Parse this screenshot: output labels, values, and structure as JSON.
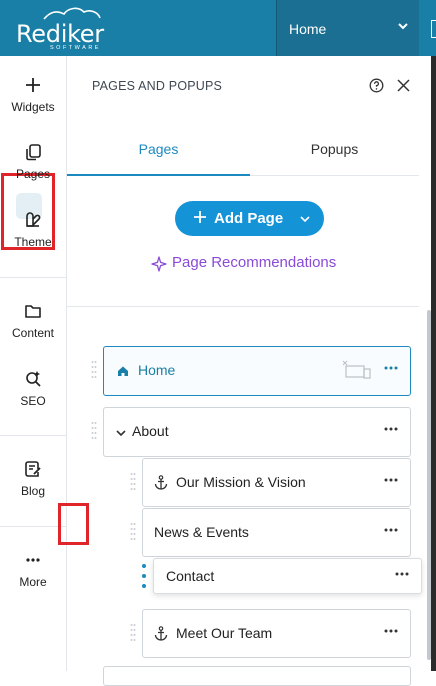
{
  "topbar": {
    "logo_text": "Rediker",
    "logo_sub": "SOFTWARE",
    "current_page": "Home",
    "bg_color": "#1a7fa6"
  },
  "rail": {
    "items": [
      {
        "label": "Widgets",
        "icon": "plus-icon"
      },
      {
        "label": "Pages",
        "icon": "pages-icon",
        "active": true
      },
      {
        "label": "Theme",
        "icon": "theme-icon"
      },
      {
        "label": "Content",
        "icon": "folder-icon"
      },
      {
        "label": "SEO",
        "icon": "seo-search-icon"
      },
      {
        "label": "Blog",
        "icon": "blog-icon"
      },
      {
        "label": "More",
        "icon": "ellipsis-icon"
      }
    ]
  },
  "panel": {
    "title": "PAGES AND POPUPS",
    "tabs": [
      "Pages",
      "Popups"
    ],
    "active_tab": "Pages",
    "add_page_label": "Add Page",
    "recommendations_label": "Page Recommendations",
    "accent_color": "#1593d7",
    "reco_color": "#8a4bd6"
  },
  "tree": {
    "home": "Home",
    "about": "About",
    "mission": "Our Mission & Vision",
    "news": "News & Events",
    "contact": "Contact",
    "team": "Meet Our Team"
  }
}
